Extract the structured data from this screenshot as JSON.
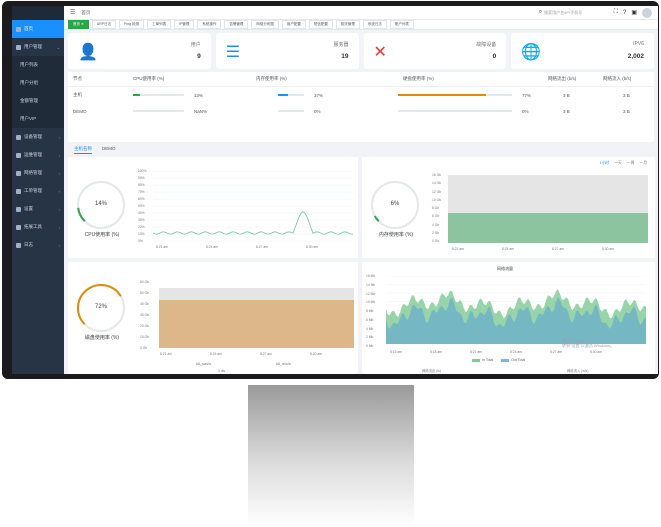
{
  "sidebar": {
    "items": [
      {
        "label": "首页",
        "active": true
      },
      {
        "label": "用户管理",
        "caret": "⌄"
      },
      {
        "label": "用户列表",
        "sub": true
      },
      {
        "label": "用户分组",
        "sub": true
      },
      {
        "label": "金额管理",
        "sub": true
      },
      {
        "label": "用户VIP",
        "sub": true
      },
      {
        "label": "设备管理",
        "caret": "›"
      },
      {
        "label": "运维管理",
        "caret": "›"
      },
      {
        "label": "网络管理",
        "caret": "›"
      },
      {
        "label": "工单管理",
        "caret": "›"
      },
      {
        "label": "设置",
        "caret": "›"
      },
      {
        "label": "拓展工具",
        "caret": "›"
      },
      {
        "label": "日志",
        "caret": "›"
      }
    ]
  },
  "topbar": {
    "menu_icon": "☰",
    "breadcrumb": "首页",
    "search_placeholder": "搜索用户名/IP/手机号"
  },
  "tabs": [
    "首页 ✕",
    "ARP日志",
    "Ping 检测",
    "工单列表",
    "IP管理",
    "系统操作",
    "告警管理",
    "网络分布图",
    "用户配置",
    "短信配置",
    "相关管理",
    "系统日志",
    "账户列表"
  ],
  "cards": [
    {
      "label": "用户",
      "value": "9",
      "icon": "user-icon",
      "color": "#1bb39c"
    },
    {
      "label": "服务器",
      "value": "19",
      "icon": "server-icon",
      "color": "#1890ff"
    },
    {
      "label": "故障设备",
      "value": "0",
      "icon": "tools-icon",
      "color": "#e8362f"
    },
    {
      "label": "IPV6",
      "value": "2,002",
      "icon": "globe-icon",
      "color": "#1bb39c"
    }
  ],
  "stats": {
    "headers": [
      "节点",
      "CPU使用率 (%)",
      "内存使用率 (%)",
      "硬盘使用率 (%)",
      "网络流出 (b/s)",
      "网络流入 (b/s)"
    ],
    "rows": [
      {
        "name": "主机",
        "cpu": "13%",
        "mem": "37%",
        "disk": "77%",
        "out": "3 B",
        "in": "3 B",
        "cpu_v": 0.13,
        "mem_v": 0.37,
        "disk_v": 0.77
      },
      {
        "name": "DEMO",
        "cpu": "NaN%",
        "mem": "0%",
        "disk": "0%",
        "out": "3 B",
        "in": "3 B",
        "cpu_v": 0,
        "mem_v": 0,
        "disk_v": 0
      }
    ],
    "colors": {
      "cpu": "#28a745",
      "mem": "#1890ff",
      "disk": "#e68a00"
    }
  },
  "subtabs": [
    "主机名称",
    "DEMO"
  ],
  "cpu_panel": {
    "gauge_value": "14%",
    "gauge_label": "CPU使用率 (%)",
    "y_ticks": [
      "100%",
      "90%",
      "80%",
      "70%",
      "60%",
      "50%",
      "40%",
      "30%",
      "20%",
      "10%",
      "0%"
    ],
    "x_ticks": [
      "8:21 am",
      "8:24 am",
      "8:27 am",
      "8:30 am"
    ]
  },
  "mem_panel": {
    "gauge_value": "6%",
    "gauge_label": "内存使用率 (%)",
    "controls": [
      "1小时",
      "一天",
      "一周",
      "一月"
    ],
    "y_ticks": [
      "16 Gb",
      "14 Gb",
      "12 Gb",
      "10 Gb",
      "8 Gb",
      "6 Gb",
      "4 Gb",
      "2 Gb",
      "0 Gb"
    ],
    "x_ticks": [
      "8:21 am",
      "8:24 am",
      "8:27 am",
      "8:30 am"
    ]
  },
  "disk_panel": {
    "gauge_value": "72%",
    "gauge_label": "磁盘使用率 (%)",
    "y_ticks": [
      "60 Gb",
      "50 Gb",
      "40 Gb",
      "30 Gb",
      "20 Gb",
      "10 Gb",
      "0 Gb"
    ],
    "x_ticks": [
      "8:21 am",
      "8:24 am",
      "8:27 am",
      "8:30 am"
    ],
    "dev_labels": [
      "k8_sas/s",
      "k8_w/s/s"
    ],
    "bottom": "3 dls"
  },
  "net_panel": {
    "title": "网络流量",
    "y_ticks": [
      "16 Mb",
      "14 Mb",
      "12 Mb",
      "10 Mb",
      "8 Mb",
      "6 Mb",
      "4 Mb",
      "2 Mb",
      "0 Mb"
    ],
    "x_ticks": [
      "8:15 am",
      "8:18 am",
      "8:21 am",
      "8:24 am",
      "8:27 am",
      "8:30 am"
    ],
    "legend": [
      {
        "name": "In Total",
        "color": "#86c9a0"
      },
      {
        "name": "Out Total",
        "color": "#7fb5e8"
      }
    ],
    "bottom_left": "网络流出 (/s)",
    "bottom_right": "网络流入 (/s/s)",
    "watermark_1": "激活 Windows",
    "watermark_2": "转到\"设置\"以激活 Windows。"
  }
}
